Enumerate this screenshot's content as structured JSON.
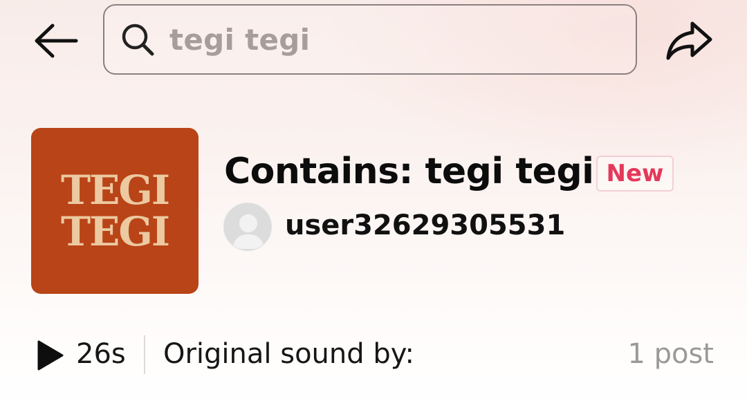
{
  "header": {
    "back_icon": "arrow-left-icon",
    "search": {
      "icon": "search-icon",
      "query": "tegi tegi"
    },
    "share_icon": "share-arrow-icon"
  },
  "sound": {
    "cover_lines": [
      "TEGI",
      "TEGI"
    ],
    "title": "Contains: tegi tegi",
    "badge": "New",
    "author": "user32629305531",
    "duration": "26s",
    "original_label": "Original sound by:",
    "post_count": "1 post"
  },
  "colors": {
    "cover_bg": "#b94418",
    "cover_text": "#ecc9a0",
    "badge_text": "#e4395a"
  }
}
